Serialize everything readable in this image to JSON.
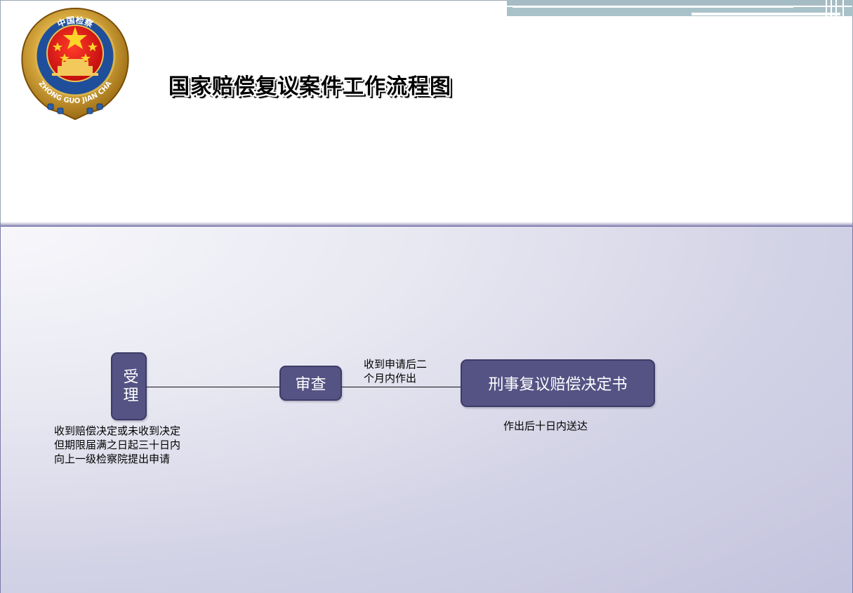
{
  "header": {
    "title": "国家赔偿复议案件工作流程图",
    "emblem": {
      "name": "procuratorate-emblem",
      "top_text": "中国检察",
      "bottom_text": "ZHONG GUO JIAN CHA"
    }
  },
  "flow": {
    "steps": [
      {
        "id": "accept",
        "label": "受理",
        "note_lines": [
          "收到赔偿决定或未收到决定",
          "但期限届满之日起三十日内",
          "向上一级检察院提出申请"
        ]
      },
      {
        "id": "review",
        "label": "审查",
        "note_lines": [
          "收到申请后二",
          "个月内作出"
        ]
      },
      {
        "id": "decision",
        "label": "刑事复议赔偿决定书",
        "note_lines": [
          "作出后十日内送达"
        ]
      }
    ]
  },
  "colors": {
    "node_fill": "#555384",
    "node_border": "#3d3b66",
    "panel_edge": "#c4c3de",
    "deco_bar": "#a9c1c8"
  }
}
